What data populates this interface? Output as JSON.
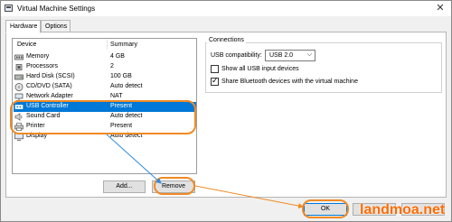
{
  "window": {
    "title": "Virtual Machine Settings",
    "close_glyph": "✕"
  },
  "tabs": [
    {
      "label": "Hardware"
    },
    {
      "label": "Options"
    }
  ],
  "device_list": {
    "header_device": "Device",
    "header_summary": "Summary",
    "rows": [
      {
        "name": "Memory",
        "summary": "4 GB",
        "icon": "memory-icon"
      },
      {
        "name": "Processors",
        "summary": "2",
        "icon": "processor-icon"
      },
      {
        "name": "Hard Disk (SCSI)",
        "summary": "100 GB",
        "icon": "hard-disk-icon"
      },
      {
        "name": "CD/DVD (SATA)",
        "summary": "Auto detect",
        "icon": "cd-dvd-icon"
      },
      {
        "name": "Network Adapter",
        "summary": "NAT",
        "icon": "network-icon"
      },
      {
        "name": "USB Controller",
        "summary": "Present",
        "icon": "usb-icon"
      },
      {
        "name": "Sound Card",
        "summary": "Auto detect",
        "icon": "speaker-icon"
      },
      {
        "name": "Printer",
        "summary": "Present",
        "icon": "printer-icon"
      },
      {
        "name": "Display",
        "summary": "Auto detect",
        "icon": "display-icon"
      }
    ],
    "selected": "USB Controller"
  },
  "buttons": {
    "add": "Add...",
    "remove": "Remove",
    "ok": "OK",
    "cancel": "",
    "help": ""
  },
  "connections": {
    "title": "Connections",
    "usb_compat_label": "USB compatibility:",
    "usb_compat_value": "USB 2.0",
    "show_all_usb": {
      "label": "Show all USB input devices",
      "checked": false
    },
    "share_bluetooth": {
      "label": "Share Bluetooth devices with the virtual machine",
      "checked": true
    }
  },
  "watermark": "landmoa.net",
  "colors": {
    "selection": "#0078d7",
    "highlight": "#f08a24",
    "arrow": "#2e8be0",
    "watermark": "#ff6a00"
  }
}
